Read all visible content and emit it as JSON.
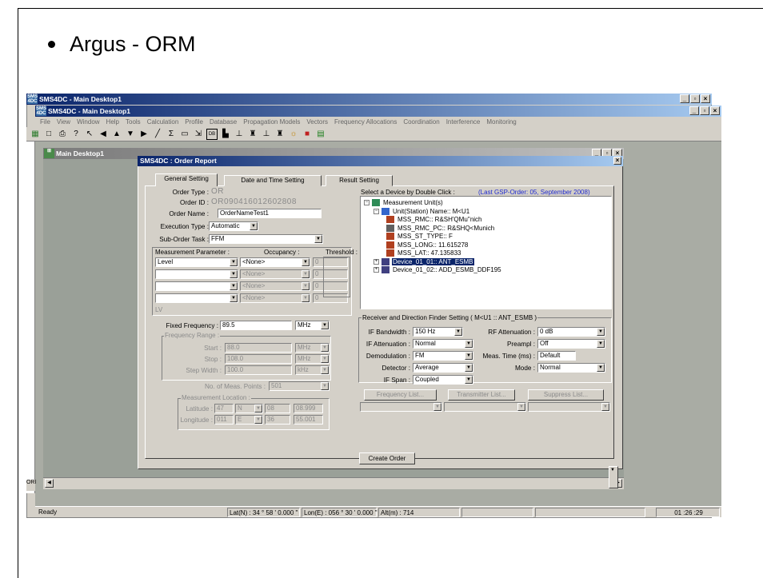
{
  "slide": {
    "bullet": "Argus - ORM"
  },
  "outer_window": {
    "title": "SMS4DC - Main Desktop1"
  },
  "inner_window": {
    "title": "SMS4DC - Main Desktop1"
  },
  "menu": [
    "File",
    "View",
    "Window",
    "Help",
    "Tools",
    "Calculation",
    "Profile",
    "Database",
    "Propagation Models",
    "Vectors",
    "Frequency Allocations",
    "Coordination",
    "Interference",
    "Monitoring"
  ],
  "child_window": {
    "title": "Main Desktop1"
  },
  "dialog": {
    "title": "SMS4DC : Order Report",
    "tabs": [
      "General Setting",
      "Date and Time Setting",
      "Result Setting"
    ],
    "order_type_label": "Order Type :",
    "order_type_value": "OR",
    "order_id_label": "Order ID :",
    "order_id_value": "OR090416012602808",
    "order_name_label": "Order Name :",
    "order_name_value": "OrderNameTest1",
    "execution_type_label": "Execution Type :",
    "execution_type_value": "Automatic",
    "sub_order_label": "Sub-Order Task :",
    "sub_order_value": "FFM",
    "meas_param_header": "Measurement Parameter :",
    "occupancy_header": "Occupancy :",
    "threshold_header": "Threshold :",
    "param_rows": [
      {
        "param": "Level",
        "occupancy": "<None>",
        "threshold": "0",
        "disabled": false
      },
      {
        "param": "",
        "occupancy": "<None>",
        "threshold": "0",
        "disabled": true
      },
      {
        "param": "",
        "occupancy": "<None>",
        "threshold": "0",
        "disabled": true
      },
      {
        "param": "",
        "occupancy": "<None>",
        "threshold": "0",
        "disabled": true
      }
    ],
    "lv_label": "LV",
    "fixed_freq_label": "Fixed Frequency :",
    "fixed_freq_value": "89.5",
    "fixed_freq_unit": "MHz",
    "freq_range_label": "Frequency Range :",
    "start_label": "Start :",
    "start_value": "88.0",
    "start_unit": "MHz",
    "stop_label": "Stop :",
    "stop_value": "108.0",
    "stop_unit": "MHz",
    "step_label": "Step Width :",
    "step_value": "100.0",
    "step_unit": "kHz",
    "num_meas_label": "No. of Meas. Points :",
    "num_meas_value": "501",
    "meas_loc_label": "Measurement Location :",
    "lat_label": "Latitude :",
    "lat_deg": "47",
    "lat_hem": "N",
    "lat_min": "08",
    "lat_sec": "08.999",
    "lon_label": "Longitude :",
    "lon_deg": "011",
    "lon_hem": "E",
    "lon_min": "36",
    "lon_sec": "55.001",
    "device_select_label": "Select a Device by Double Click :",
    "last_gsp_order": "(Last GSP-Order: 05, September 2008)",
    "tree": [
      "Measurement Unit(s)",
      "Unit(Station) Name:: M<U1",
      "MSS_RMC:: R&SH'QMu''nich",
      "MSS_RMC_PC:: R&SHQ<Munich",
      "MSS_ST_TYPE:: F",
      "MSS_LONG:: 11.615278",
      "MSS_LAT:: 47.135833",
      "Device_01_01:: ANT_ESMB",
      "Device_01_02:: ADD_ESMB_DDF195"
    ],
    "rx_group_label": "Receiver and Direction Finder Setting ( M<U1 :: ANT_ESMB )",
    "if_bw_label": "IF Bandwidth :",
    "if_bw_value": "150 Hz",
    "rf_att_label": "RF Attenuation :",
    "rf_att_value": "0 dB",
    "if_att_label": "IF Attenuation :",
    "if_att_value": "Normal",
    "preampl_label": "Preampl :",
    "preampl_value": "Off",
    "demod_label": "Demodulation :",
    "demod_value": "FM",
    "meas_time_label": "Meas. Time (ms) :",
    "meas_time_value": "Default",
    "detector_label": "Detector :",
    "detector_value": "Average",
    "mode_label": "Mode :",
    "mode_value": "Normal",
    "if_span_label": "IF Span :",
    "if_span_value": "Coupled",
    "freq_list_btn": "Frequency List...",
    "tx_list_btn": "Transmitter List...",
    "suppress_list_btn": "Suppress List...",
    "create_order_btn": "Create Order"
  },
  "statusbar": {
    "ready": "Ready",
    "lat": "Lat(N) : 34 ° 58 ' 0.000 \"",
    "lon": "Lon(E) : 056 ° 30 ' 0.000 \"",
    "alt": "Alt(m) : 714",
    "time": "01 :26 :29"
  },
  "side_label": "ORI"
}
